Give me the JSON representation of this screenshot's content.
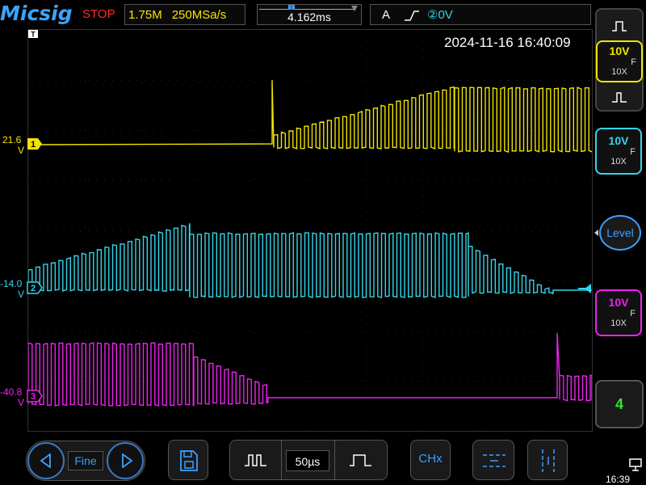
{
  "topbar": {
    "brand": "Micsig",
    "run_state": "STOP",
    "memory_depth": "1.75M",
    "sample_rate": "250MSa/s",
    "trigger_time": "4.162ms",
    "trigger_source": "A",
    "trigger_edge_icon": "rising-edge-icon",
    "trigger_level": "②0V"
  },
  "timestamp": "2024-11-16 16:40:09",
  "channels": [
    {
      "id": "1",
      "color": "#f0e400",
      "offset_label": "21.6",
      "unit": "V",
      "volts_div": "10V",
      "probe": "10X",
      "coupling": "F"
    },
    {
      "id": "2",
      "color": "#33d6ea",
      "offset_label": "-14.0",
      "unit": "V",
      "volts_div": "10V",
      "probe": "10X",
      "coupling": "F"
    },
    {
      "id": "3",
      "color": "#ee22ee",
      "offset_label": "-40.8",
      "unit": "V",
      "volts_div": "10V",
      "probe": "10X",
      "coupling": "F"
    }
  ],
  "right_panel": {
    "level_label": "Level",
    "channel_count_label": "4"
  },
  "bottom_bar": {
    "fine_label": "Fine",
    "timebase": "50µs",
    "chx_label": "CHx",
    "clock": "16:39"
  },
  "icons": {
    "trigger_pointer": "T",
    "save": "save-icon",
    "pulse_wide": "pulse-wide-icon",
    "pulse_narrow": "pulse-narrow-icon",
    "cursor_h": "horizontal-cursor-icon",
    "cursor_v": "vertical-cursor-icon",
    "usb": "usb-icon"
  }
}
